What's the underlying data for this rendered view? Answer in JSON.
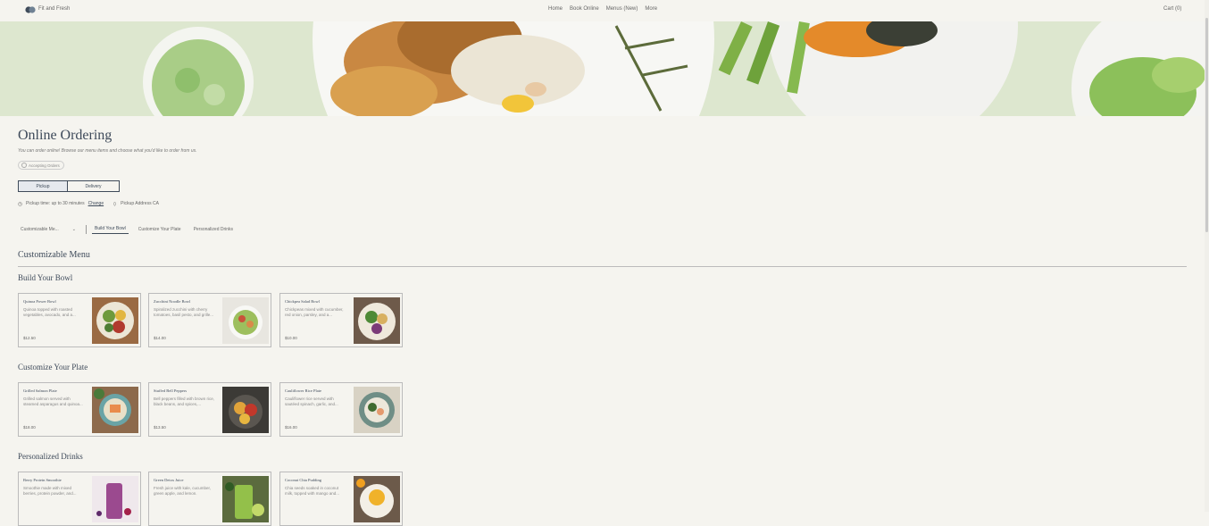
{
  "header": {
    "brand": "Fit and Fresh",
    "nav": [
      "Home",
      "Book Online",
      "Menus (New)",
      "More"
    ],
    "cart": "Cart (0)"
  },
  "page": {
    "title": "Online Ordering",
    "description": "You can order online! Browse our menu items and choose what you'd like to order from us.",
    "badge": "Accepting Orders"
  },
  "fulfillment": {
    "pickup_label": "Pickup",
    "delivery_label": "Delivery",
    "pickup_time": "Pickup time: up to 30 minutes",
    "change_label": "Change",
    "pickup_address": "Pickup Address CA"
  },
  "filters": {
    "dropdown": "Customizable Me...",
    "tabs": [
      "Build Your Bowl",
      "Customize Your Plate",
      "Personalized Drinks"
    ]
  },
  "menu": {
    "title": "Customizable Menu",
    "sections": [
      {
        "title": "Build Your Bowl",
        "items": [
          {
            "name": "Quinoa Power Bowl",
            "desc": "Quinoa topped with roasted vegetables, avocado, and a...",
            "price": "$12.50"
          },
          {
            "name": "Zucchini Noodle Bowl",
            "desc": "Spiralized zucchini with cherry tomatoes, basil pesto, and grille...",
            "price": "$14.00"
          },
          {
            "name": "Chickpea Salad Bowl",
            "desc": "Chickpeas mixed with cucumber, red onion, parsley, and a...",
            "price": "$10.00"
          }
        ]
      },
      {
        "title": "Customize Your Plate",
        "items": [
          {
            "name": "Grilled Salmon Plate",
            "desc": "Grilled salmon served with steamed asparagus and quinoa...",
            "price": "$18.00"
          },
          {
            "name": "Stuffed Bell Peppers",
            "desc": "Bell peppers filled with brown rice, black beans, and spices,...",
            "price": "$13.50"
          },
          {
            "name": "Cauliflower Rice Plate",
            "desc": "Cauliflower rice served with sautéed spinach, garlic, and...",
            "price": "$16.00"
          }
        ]
      },
      {
        "title": "Personalized Drinks",
        "items": [
          {
            "name": "Berry Protein Smoothie",
            "desc": "Smoothie made with mixed berries, protein powder, and...",
            "price": ""
          },
          {
            "name": "Green Detox Juice",
            "desc": "Fresh juice with kale, cucumber, green apple, and lemon.",
            "price": ""
          },
          {
            "name": "Coconut Chia Pudding",
            "desc": "Chia seeds soaked in coconut milk, topped with mango and...",
            "price": ""
          }
        ]
      }
    ]
  },
  "colors": {
    "accent": "#3f4b5a",
    "background": "#f5f4ef",
    "banner": "#dfe8d2"
  }
}
